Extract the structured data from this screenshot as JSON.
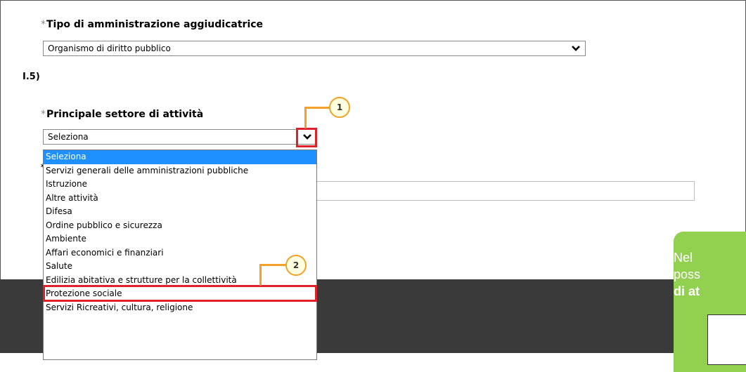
{
  "form": {
    "required_marker": "*",
    "field1_label": "Tipo di amministrazione aggiudicatrice",
    "field1_value": "Organismo di diritto pubblico",
    "section_label": "I.5)",
    "field2_label": "Principale settore di attività",
    "field2_value": "Seleziona"
  },
  "dropdown": {
    "options": [
      "Seleziona",
      "Servizi generali delle amministrazioni pubbliche",
      "Istruzione",
      "Altre attività",
      "Difesa",
      "Ordine pubblico e sicurezza",
      "Ambiente",
      "Affari economici e finanziari",
      "Salute",
      "Edilizia abitativa e strutture per la collettività",
      "Protezione sociale",
      "Servizi Ricreativi, cultura, religione"
    ],
    "selected_index": 0
  },
  "annotations": {
    "step1": "1",
    "step2": "2",
    "highlight_color": "#e0202a",
    "badge_color": "#f4a12a"
  },
  "callout": {
    "line1": "Nel",
    "line2": "poss",
    "line3": "di at",
    "bg_color": "#92d050"
  }
}
